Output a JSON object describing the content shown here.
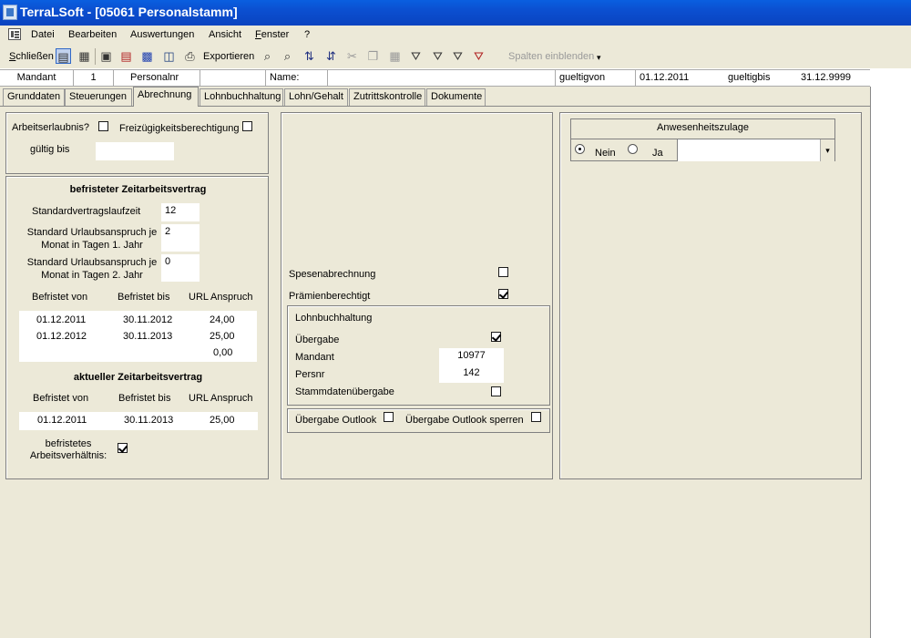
{
  "window": {
    "title": "TerraLSoft - [05061 Personalstamm]"
  },
  "menu": [
    "Datei",
    "Bearbeiten",
    "Auswertungen",
    "Ansicht",
    "Fenster",
    "?"
  ],
  "toolbar": {
    "close_label": "Schließen",
    "export_label": "Exportieren",
    "columns_label": "Spalten einblenden"
  },
  "info": {
    "mandant_label": "Mandant",
    "mandant_value": "1",
    "personalnr_label": "Personalnr",
    "personalnr_value": "",
    "name_label": "Name:",
    "name_value": "",
    "gueltigvon_label": "gueltigvon",
    "gueltigvon_value": "01.12.2011",
    "gueltigbis_label": "gueltigbis",
    "gueltigbis_value": "31.12.9999"
  },
  "tabs": [
    {
      "label": "Grunddaten",
      "active": false
    },
    {
      "label": "Steuerungen",
      "active": false
    },
    {
      "label": "Abrechnung",
      "active": true
    },
    {
      "label": "Lohnbuchhaltung",
      "active": false
    },
    {
      "label": "Lohn/Gehalt",
      "active": false
    },
    {
      "label": "Zutrittskontrolle",
      "active": false
    },
    {
      "label": "Dokumente",
      "active": false
    }
  ],
  "permit": {
    "arbeitserlaubnis_label": "Arbeitserlaubnis?",
    "arbeitserlaubnis_checked": false,
    "freizuegigkeit_label": "Freizügigkeitsberechtigung",
    "freizuegigkeit_checked": false,
    "gueltig_bis_label": "gültig bis",
    "gueltig_bis_value": ""
  },
  "befristet": {
    "title": "befristeter Zeitarbeitsvertrag",
    "laufzeit_label": "Standardvertragslaufzeit",
    "laufzeit_value": "12",
    "urlaub1_label_line1": "Standard Urlaubsanspruch je",
    "urlaub1_label_line2": "Monat in Tagen 1. Jahr",
    "urlaub1_value": "2",
    "urlaub2_label_line1": "Standard Urlaubsanspruch je",
    "urlaub2_label_line2": "Monat in Tagen 2. Jahr",
    "urlaub2_value": "0",
    "columns": [
      "Befristet von",
      "Befristet bis",
      "URL Anspruch"
    ],
    "rows": [
      [
        "01.12.2011",
        "30.11.2012",
        "24,00"
      ],
      [
        "01.12.2012",
        "30.11.2013",
        "25,00"
      ],
      [
        "",
        "",
        "0,00"
      ]
    ]
  },
  "aktuell": {
    "title": "aktueller Zeitarbeitsvertrag",
    "columns": [
      "Befristet von",
      "Befristet bis",
      "URL Anspruch"
    ],
    "row": [
      "01.12.2011",
      "30.11.2013",
      "25,00"
    ],
    "befristet_label_line1": "befristetes",
    "befristet_label_line2": "Arbeitsverhältnis:",
    "befristet_checked": true
  },
  "middle": {
    "spesen_label": "Spesenabrechnung",
    "spesen_checked": false,
    "praemien_label": "Prämienberechtigt",
    "praemien_checked": true,
    "lohn_title": "Lohnbuchhaltung",
    "uebergabe_label": "Übergabe",
    "uebergabe_checked": true,
    "mandant_label": "Mandant",
    "mandant_value": "10977",
    "persnr_label": "Persnr",
    "persnr_value": "142",
    "stamm_label": "Stammdatenübergabe",
    "stamm_checked": false,
    "outlook_label": "Übergabe Outlook",
    "outlook_checked": false,
    "outlook_sperren_label": "Übergabe Outlook sperren",
    "outlook_sperren_checked": false
  },
  "zulage": {
    "title": "Anwesenheitszulage",
    "nein_label": "Nein",
    "nein_selected": true,
    "ja_label": "Ja",
    "ja_selected": false,
    "select_value": ""
  }
}
